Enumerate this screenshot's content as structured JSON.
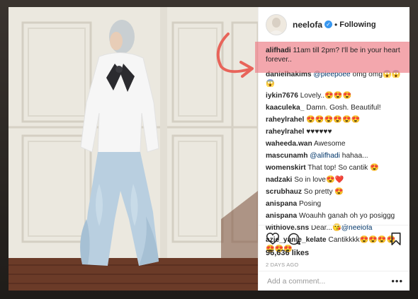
{
  "post": {
    "username": "neelofa",
    "verified_mark": "✓",
    "dot": "•",
    "following_label": "Following"
  },
  "comments": [
    {
      "user": "alifhadi",
      "text": "11am till 2pm? I'll be in your heart forever..",
      "highlighted": true
    },
    {
      "user": "danielhakims",
      "mention": "@pieepoee",
      "text": "omg omg😱😱😱"
    },
    {
      "user": "iykin7676",
      "text": "Lovely..😍😍😍"
    },
    {
      "user": "kaaculeka_",
      "text": "Damn. Gosh. Beautiful!"
    },
    {
      "user": "raheylrahel",
      "text": "😍😍😍😍😍😍"
    },
    {
      "user": "raheylrahel",
      "text": "♥♥♥♥♥♥"
    },
    {
      "user": "waheeda.wan",
      "text": "Awesome"
    },
    {
      "user": "mascunamh",
      "mention": "@alifhadi",
      "text": "hahaa..."
    },
    {
      "user": "womenskirt",
      "text": "That top! So cantik 😍"
    },
    {
      "user": "nadzaki",
      "text": "So in love😍❤️"
    },
    {
      "user": "scrubhauz",
      "text": "So pretty 😍"
    },
    {
      "user": "anispana",
      "text": "Posing"
    },
    {
      "user": "anispana",
      "text": "Woauhh ganah oh yo posiggg"
    },
    {
      "user": "withlove.sns",
      "text": "Dear...😘",
      "mention": "@neelofa"
    },
    {
      "user": "azie_yanie_kelate",
      "text": "Cantikkkk😍😍😍😍😍😍😍"
    }
  ],
  "actions": {
    "like_icon": "heart-icon",
    "comment_icon": "comment-bubble-icon",
    "save_icon": "bookmark-icon"
  },
  "likes": "96,636 likes",
  "timestamp": "2 DAYS AGO",
  "add_comment": {
    "placeholder": "Add a comment...",
    "more_label": "•••"
  },
  "colors": {
    "highlight": "#ee7e86",
    "arrow": "#e8645a",
    "verified": "#3897f0",
    "link": "#003569"
  }
}
